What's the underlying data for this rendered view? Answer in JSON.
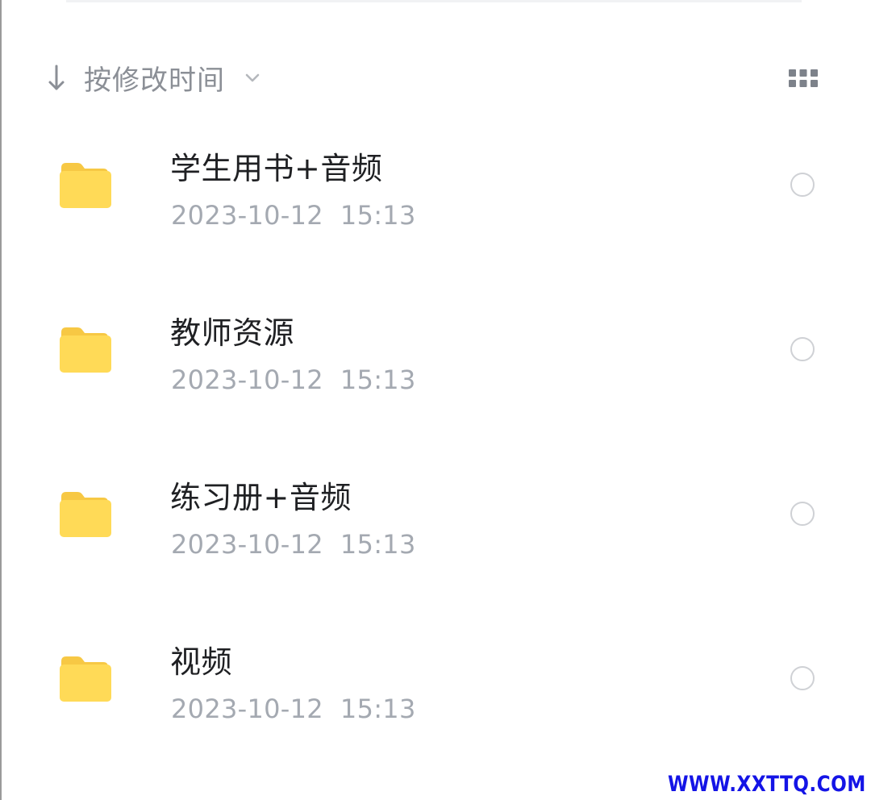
{
  "sort": {
    "label": "按修改时间",
    "arrow_icon": "arrow-down-icon",
    "chevron_icon": "chevron-down-icon"
  },
  "view_toggle": {
    "icon": "grid-view-icon"
  },
  "files": [
    {
      "name": "学生用书+音频",
      "modified": "2023-10-12  15:13",
      "icon": "folder-icon"
    },
    {
      "name": "教师资源",
      "modified": "2023-10-12  15:13",
      "icon": "folder-icon"
    },
    {
      "name": "练习册+音频",
      "modified": "2023-10-12  15:13",
      "icon": "folder-icon"
    },
    {
      "name": "视频",
      "modified": "2023-10-12  15:13",
      "icon": "folder-icon"
    }
  ],
  "watermark": "WWW.XXTTQ.COM",
  "colors": {
    "folder_front": "#FFDA57",
    "folder_tab": "#F7C844",
    "muted_text": "#A4A9B1",
    "primary_text": "#1F2023",
    "watermark": "#1414E6"
  }
}
